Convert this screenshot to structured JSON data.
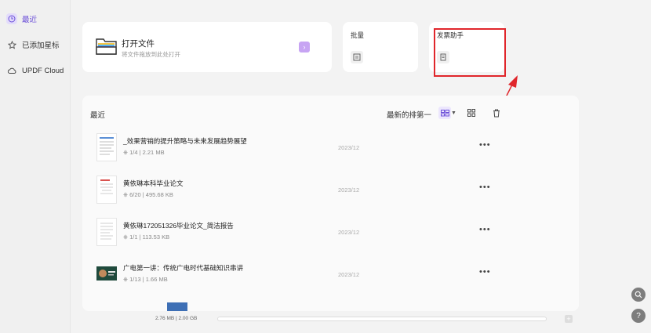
{
  "sidebar": {
    "items": [
      {
        "label": "最近",
        "icon": "clock-icon",
        "active": true
      },
      {
        "label": "已添加星标",
        "icon": "star-icon"
      },
      {
        "label": "UPDF Cloud",
        "icon": "cloud-icon"
      }
    ]
  },
  "open_file": {
    "title": "打开文件",
    "subtitle": "将文件拖放到此处打开"
  },
  "tiles": {
    "batch": {
      "title": "批量"
    },
    "invoice": {
      "title": "发票助手"
    }
  },
  "recent": {
    "title": "最近",
    "sort_label": "最新的排第一",
    "files": [
      {
        "name": "_效果营销的提升策略与未来发展趋势展望",
        "meta": "1/4 | 2.21 MB",
        "date": "2023/12"
      },
      {
        "name": "黄依琳本科毕业论文",
        "meta": "6/20 | 495.68 KB",
        "date": "2023/12"
      },
      {
        "name": "黄依琳172051326毕业论文_简洁报告",
        "meta": "1/1 | 113.53 KB",
        "date": "2023/12"
      },
      {
        "name": "广电第一讲：传统广电时代基础知识串讲",
        "meta": "1/13 | 1.66 MB",
        "date": "2023/12"
      }
    ]
  },
  "storage": {
    "text": "2.76 MB | 2.00 GB"
  },
  "accent_color": "#6b4fd8",
  "highlight_color": "#e0262b"
}
